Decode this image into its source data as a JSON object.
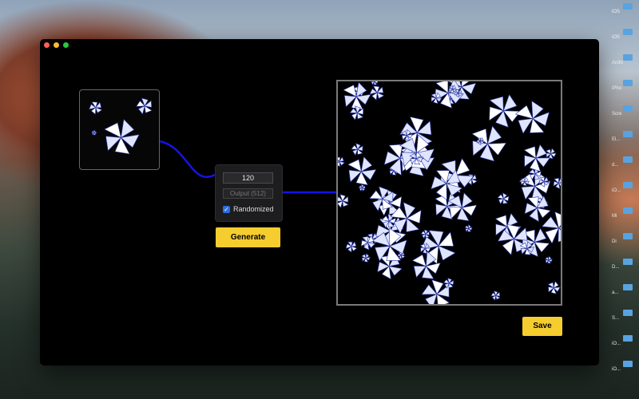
{
  "desktop": {
    "items": [
      "iOS",
      "iOS",
      "Archi",
      "iPho",
      "Scre",
      "El...",
      "d...",
      "iO...",
      "Mi",
      "Di",
      "D...",
      "a...",
      "S...",
      "iO...",
      "iO..."
    ]
  },
  "window": {
    "traffic_lights": [
      "close",
      "minimize",
      "maximize"
    ]
  },
  "controls": {
    "seed_value": "120",
    "output_placeholder": "Output (512)",
    "randomized_label": "Randomized",
    "randomized_checked": true,
    "generate_label": "Generate"
  },
  "output": {
    "save_label": "Save"
  },
  "colors": {
    "accent_button": "#f6cd2e",
    "connector": "#1414e6",
    "checkbox": "#2b6fde"
  }
}
